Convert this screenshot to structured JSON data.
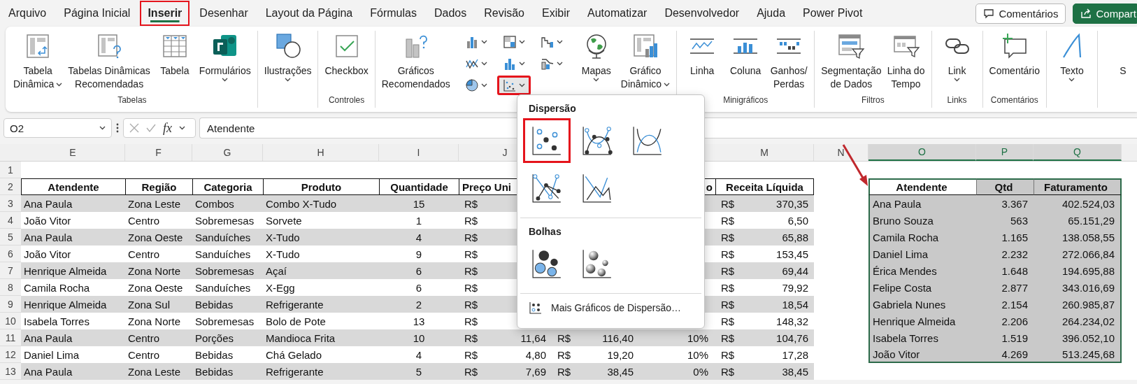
{
  "menu_tabs": [
    {
      "label": "Arquivo",
      "selected": false,
      "highlighted": false
    },
    {
      "label": "Página Inicial",
      "selected": false,
      "highlighted": false
    },
    {
      "label": "Inserir",
      "selected": true,
      "highlighted": true
    },
    {
      "label": "Desenhar",
      "selected": false,
      "highlighted": false
    },
    {
      "label": "Layout da Página",
      "selected": false,
      "highlighted": false
    },
    {
      "label": "Fórmulas",
      "selected": false,
      "highlighted": false
    },
    {
      "label": "Dados",
      "selected": false,
      "highlighted": false
    },
    {
      "label": "Revisão",
      "selected": false,
      "highlighted": false
    },
    {
      "label": "Exibir",
      "selected": false,
      "highlighted": false
    },
    {
      "label": "Automatizar",
      "selected": false,
      "highlighted": false
    },
    {
      "label": "Desenvolvedor",
      "selected": false,
      "highlighted": false
    },
    {
      "label": "Ajuda",
      "selected": false,
      "highlighted": false
    },
    {
      "label": "Power Pivot",
      "selected": false,
      "highlighted": false
    }
  ],
  "header_buttons": [
    {
      "label": "Comentários",
      "kind": "comments"
    },
    {
      "label": "Compart",
      "kind": "share"
    }
  ],
  "ribbon_groups": [
    {
      "label": "Tabelas",
      "items": [
        {
          "kind": "pivot-table",
          "lines": [
            "Tabela",
            "Dinâmica"
          ],
          "dropdown": true
        },
        {
          "kind": "recommended-pivot",
          "lines": [
            "Tabelas Dinâmicas",
            "Recomendadas"
          ]
        },
        {
          "kind": "table",
          "lines": [
            "Tabela"
          ]
        },
        {
          "kind": "forms",
          "lines": [
            "Formulários"
          ],
          "dropdown": true
        }
      ]
    },
    {
      "items": [
        {
          "kind": "illustrations",
          "lines": [
            "Ilustrações"
          ],
          "dropdown": true
        }
      ]
    },
    {
      "label": "Controles",
      "items": [
        {
          "kind": "checkbox",
          "lines": [
            "Checkbox"
          ]
        }
      ]
    },
    {
      "items": [
        {
          "kind": "recommended-charts",
          "lines": [
            "Gráficos",
            "Recomendados"
          ]
        },
        {
          "kind": "chart-grid",
          "buttons": [
            {
              "kind": "column",
              "selected": false,
              "highlighted": false
            },
            {
              "kind": "hierarchy",
              "selected": false,
              "highlighted": false
            },
            {
              "kind": "waterfall",
              "selected": false,
              "highlighted": false
            },
            {
              "kind": "line",
              "selected": false,
              "highlighted": false
            },
            {
              "kind": "statistic",
              "selected": false,
              "highlighted": false
            },
            {
              "kind": "combo",
              "selected": false,
              "highlighted": false
            },
            {
              "kind": "pie",
              "selected": false,
              "highlighted": false
            },
            {
              "kind": "scatter",
              "selected": true,
              "highlighted": true
            }
          ]
        },
        {
          "kind": "maps",
          "lines": [
            "Mapas"
          ],
          "dropdown": true
        },
        {
          "kind": "pivot-chart",
          "lines": [
            "Gráfico",
            "Dinâmico"
          ],
          "dropdown": true
        }
      ]
    },
    {
      "label": "Minigráficos",
      "items": [
        {
          "kind": "sparkline-line",
          "lines": [
            "Linha"
          ]
        },
        {
          "kind": "sparkline-column",
          "lines": [
            "Coluna"
          ]
        },
        {
          "kind": "sparkline-winloss",
          "lines": [
            "Ganhos/",
            "Perdas"
          ]
        }
      ]
    },
    {
      "label": "Filtros",
      "items": [
        {
          "kind": "slicer",
          "lines": [
            "Segmentação",
            "de Dados"
          ]
        },
        {
          "kind": "timeline",
          "lines": [
            "Linha do",
            "Tempo"
          ]
        }
      ]
    },
    {
      "label": "Links",
      "items": [
        {
          "kind": "link",
          "lines": [
            "Link"
          ],
          "dropdown": true
        }
      ]
    },
    {
      "label": "Comentários",
      "items": [
        {
          "kind": "comment",
          "lines": [
            "Comentário"
          ]
        }
      ]
    },
    {
      "items": [
        {
          "kind": "text",
          "lines": [
            "Texto"
          ],
          "dropdown": true
        }
      ]
    },
    {
      "items": [
        {
          "kind": "blank",
          "lines": [
            "S"
          ]
        }
      ]
    }
  ],
  "formula_bar": {
    "name_box": "O2",
    "function_label": "fx",
    "formula": "Atendente"
  },
  "column_headers_left": [
    {
      "letter": "E",
      "selected": false
    },
    {
      "letter": "F",
      "selected": false
    },
    {
      "letter": "G",
      "selected": false
    },
    {
      "letter": "H",
      "selected": false
    },
    {
      "letter": "I",
      "selected": false
    },
    {
      "letter": "J",
      "selected": false
    }
  ],
  "column_headers_right": [
    {
      "letter": "M",
      "selected": false
    },
    {
      "letter": "N",
      "selected": false
    },
    {
      "letter": "O",
      "selected": true
    },
    {
      "letter": "P",
      "selected": true
    },
    {
      "letter": "Q",
      "selected": true
    }
  ],
  "row_numbers": [
    "1",
    "2",
    "3",
    "4",
    "5",
    "6",
    "7",
    "8",
    "9",
    "10",
    "11",
    "12",
    "13"
  ],
  "main_table": {
    "columns": [
      {
        "header": "Atendente",
        "kind": "text"
      },
      {
        "header": "Região",
        "kind": "text"
      },
      {
        "header": "Categoria",
        "kind": "text"
      },
      {
        "header": "Produto",
        "kind": "text"
      },
      {
        "header": "Quantidade",
        "kind": "number"
      }
    ],
    "column_j_header": "Preço Uni",
    "column_l_header": "o",
    "receita_header": "Receita Líquida",
    "rows": [
      {
        "cells": [
          "Ana Paula",
          "Zona Leste",
          "Combos",
          "Combo X-Tudo",
          "15"
        ],
        "column_j": {
          "currency": "R$"
        },
        "receita": {
          "currency": "R$",
          "amount": "370,35"
        }
      },
      {
        "cells": [
          "João Vitor",
          "Centro",
          "Sobremesas",
          "Sorvete",
          "1"
        ],
        "column_j": {
          "currency": "R$"
        },
        "receita": {
          "currency": "R$",
          "amount": "6,50"
        }
      },
      {
        "cells": [
          "Ana Paula",
          "Zona Oeste",
          "Sanduíches",
          "X-Tudo",
          "4"
        ],
        "column_j": {
          "currency": "R$"
        },
        "receita": {
          "currency": "R$",
          "amount": "65,88"
        }
      },
      {
        "cells": [
          "João Vitor",
          "Centro",
          "Sanduíches",
          "X-Tudo",
          "9"
        ],
        "column_j": {
          "currency": "R$"
        },
        "receita": {
          "currency": "R$",
          "amount": "153,45"
        }
      },
      {
        "cells": [
          "Henrique Almeida",
          "Zona Norte",
          "Sobremesas",
          "Açaí",
          "6"
        ],
        "column_j": {
          "currency": "R$"
        },
        "receita": {
          "currency": "R$",
          "amount": "69,44"
        }
      },
      {
        "cells": [
          "Camila Rocha",
          "Zona Oeste",
          "Sanduíches",
          "X-Egg",
          "6"
        ],
        "column_j": {
          "currency": "R$"
        },
        "receita": {
          "currency": "R$",
          "amount": "79,92"
        }
      },
      {
        "cells": [
          "Henrique Almeida",
          "Zona Sul",
          "Bebidas",
          "Refrigerante",
          "2"
        ],
        "column_j": {
          "currency": "R$"
        },
        "receita": {
          "currency": "R$",
          "amount": "18,54"
        }
      },
      {
        "cells": [
          "Isabela Torres",
          "Zona Norte",
          "Sobremesas",
          "Bolo de Pote",
          "13"
        ],
        "column_j": {
          "currency": "R$"
        },
        "receita": {
          "currency": "R$",
          "amount": "148,32"
        }
      },
      {
        "cells": [
          "Ana Paula",
          "Centro",
          "Porções",
          "Mandioca Frita",
          "10"
        ],
        "column_j": {
          "currency": "R$",
          "amount": "11,64"
        },
        "column_k": {
          "currency": "R$",
          "amount": "116,40"
        },
        "column_l": "10%",
        "receita": {
          "currency": "R$",
          "amount": "104,76"
        }
      },
      {
        "cells": [
          "Daniel Lima",
          "Centro",
          "Bebidas",
          "Chá Gelado",
          "4"
        ],
        "column_j": {
          "currency": "R$",
          "amount": "4,80"
        },
        "column_k": {
          "currency": "R$",
          "amount": "19,20"
        },
        "column_l": "10%",
        "receita": {
          "currency": "R$",
          "amount": "17,28"
        }
      },
      {
        "cells": [
          "Ana Paula",
          "Zona Leste",
          "Bebidas",
          "Refrigerante",
          "5"
        ],
        "column_j": {
          "currency": "R$",
          "amount": "7,69"
        },
        "column_k": {
          "currency": "R$",
          "amount": "38,45"
        },
        "column_l": "0%",
        "receita": {
          "currency": "R$",
          "amount": "38,45"
        }
      }
    ]
  },
  "summary_table": {
    "columns": [
      {
        "header": "Atendente",
        "kind": "text",
        "active": true
      },
      {
        "header": "Qtd",
        "kind": "number",
        "active": false
      },
      {
        "header": "Faturamento",
        "kind": "number",
        "active": false
      }
    ],
    "rows": [
      [
        "Ana Paula",
        "3.367",
        "402.524,03"
      ],
      [
        "Bruno Souza",
        "563",
        "65.151,29"
      ],
      [
        "Camila Rocha",
        "1.165",
        "138.058,55"
      ],
      [
        "Daniel Lima",
        "2.232",
        "272.066,84"
      ],
      [
        "Érica Mendes",
        "1.648",
        "194.695,88"
      ],
      [
        "Felipe Costa",
        "2.877",
        "343.016,69"
      ],
      [
        "Gabriela Nunes",
        "2.154",
        "260.985,87"
      ],
      [
        "Henrique Almeida",
        "2.206",
        "264.234,02"
      ],
      [
        "Isabela Torres",
        "1.519",
        "396.052,10"
      ],
      [
        "João Vitor",
        "4.269",
        "513.245,68"
      ]
    ]
  },
  "chart_menu": {
    "sections": [
      {
        "title": "Dispersão",
        "options": [
          {
            "kind": "scatter-markers",
            "highlighted": true
          },
          {
            "kind": "scatter-smooth-markers",
            "highlighted": false
          },
          {
            "kind": "scatter-smooth",
            "highlighted": false
          },
          {
            "kind": "scatter-lines-markers",
            "highlighted": false
          },
          {
            "kind": "scatter-lines",
            "highlighted": false
          }
        ]
      },
      {
        "title": "Bolhas",
        "options": [
          {
            "kind": "bubble",
            "highlighted": false
          },
          {
            "kind": "bubble-3d",
            "highlighted": false
          }
        ]
      }
    ],
    "footer": "Mais Gráficos de Dispersão…"
  }
}
